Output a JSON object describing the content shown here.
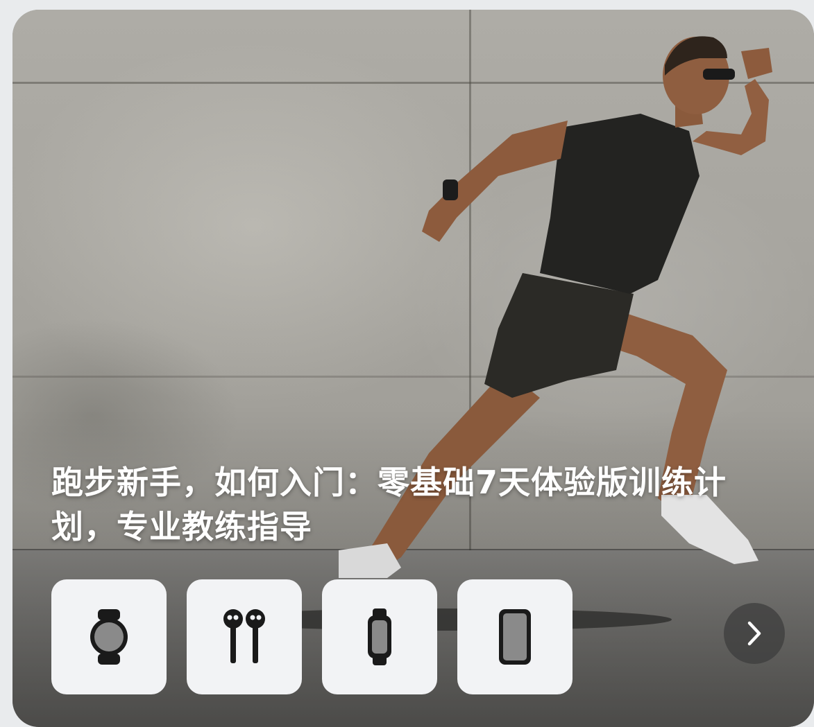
{
  "banner": {
    "title": "跑步新手，如何入门：零基础7天体验版训练计划，专业教练指导",
    "image_description": "Runner sprinting in front of a concrete wall"
  },
  "devices": [
    {
      "name": "round-smartwatch-icon"
    },
    {
      "name": "wireless-earbuds-icon"
    },
    {
      "name": "fitness-band-icon"
    },
    {
      "name": "smartphone-icon"
    }
  ],
  "next": {
    "icon": "chevron-right-icon"
  },
  "colors": {
    "tile_background": "#f2f3f5",
    "icon_dark": "#1a1a1a",
    "icon_screen": "#8a8a8a",
    "headline": "#ffffff",
    "next_button_bg": "#3c3c3c"
  }
}
